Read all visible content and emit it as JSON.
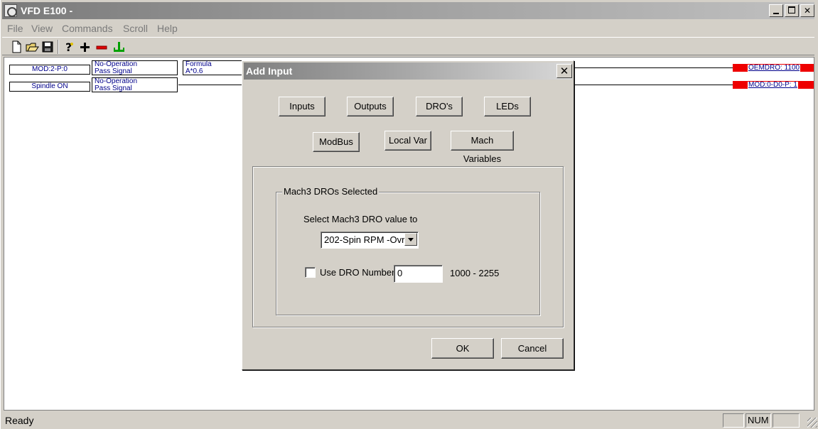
{
  "window": {
    "title": "VFD E100 -"
  },
  "menu": {
    "items": [
      "File",
      "View",
      "Commands",
      "Scroll",
      "Help"
    ]
  },
  "toolbar": {
    "tools": [
      "new-file-icon",
      "open-folder-icon",
      "save-disk-icon",
      "help-icon",
      "add-icon",
      "remove-icon",
      "insert-icon"
    ]
  },
  "ladder": {
    "rows": [
      {
        "input": "MOD:2-P:0",
        "op_line1": "No-Operation",
        "op_line2": "Pass Signal",
        "formula_line1": "Formula",
        "formula_line2": "A*0.6",
        "output": "OEMDRO: 1100"
      },
      {
        "input": "Spindle ON",
        "op_line1": "No-Operation",
        "op_line2": "Pass Signal",
        "output": "MOD:0-D0-P: 1"
      }
    ]
  },
  "dialog": {
    "title": "Add Input",
    "close": "✕",
    "tabs": {
      "inputs": "Inputs",
      "outputs": "Outputs",
      "dros": "DRO's",
      "leds": "LEDs",
      "modbus": "ModBus",
      "local_var": "Local Var",
      "mach_variables": "Mach Variables"
    },
    "group": {
      "legend": "Mach3 DROs Selected",
      "select_label": "Select Mach3 DRO value to",
      "select_value": "202-Spin RPM -Ovr",
      "checkbox_label": "Use DRO Number",
      "checkbox_checked": false,
      "dro_number_value": "0",
      "range_hint": "1000 - 2255"
    },
    "ok": "OK",
    "cancel": "Cancel"
  },
  "status": {
    "text": "Ready",
    "num": "NUM"
  },
  "colors": {
    "output_block": "#ee0000",
    "ladder_text": "#00008b"
  }
}
